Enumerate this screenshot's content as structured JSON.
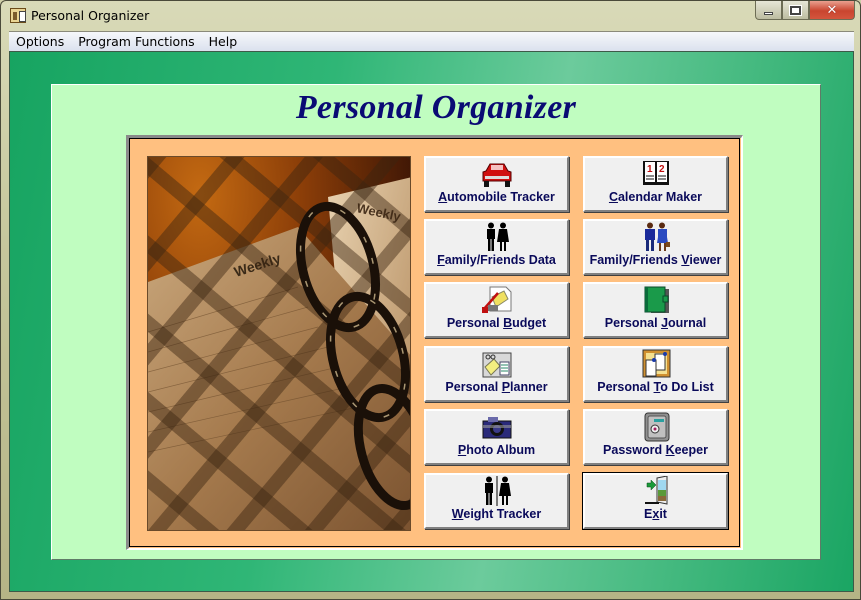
{
  "window": {
    "title": "Personal Organizer",
    "controls": {
      "minimize": "minimize",
      "maximize": "maximize",
      "close": "close"
    }
  },
  "menubar": {
    "items": [
      "Options",
      "Program Functions",
      "Help"
    ]
  },
  "main": {
    "heading": "Personal Organizer",
    "photo": {
      "caption_left": "Weekly",
      "caption_right": "Weekly"
    },
    "buttons": [
      {
        "label": "Automobile Tracker",
        "mnemonic_index": 0,
        "icon": "car-icon"
      },
      {
        "label": "Calendar Maker",
        "mnemonic_index": 0,
        "icon": "calendar-icon"
      },
      {
        "label": "Family/Friends Data",
        "mnemonic_index": 0,
        "icon": "people-icon"
      },
      {
        "label": "Family/Friends Viewer",
        "mnemonic_index": 15,
        "icon": "business-people-icon"
      },
      {
        "label": "Personal Budget",
        "mnemonic_index": 9,
        "icon": "budget-icon"
      },
      {
        "label": "Personal Journal",
        "mnemonic_index": 9,
        "icon": "journal-icon"
      },
      {
        "label": "Personal Planner",
        "mnemonic_index": 9,
        "icon": "planner-icon"
      },
      {
        "label": "Personal To Do List",
        "mnemonic_index": 9,
        "icon": "todo-list-icon"
      },
      {
        "label": "Photo Album",
        "mnemonic_index": 0,
        "icon": "camera-icon"
      },
      {
        "label": "Password Keeper",
        "mnemonic_index": 9,
        "icon": "safe-icon"
      },
      {
        "label": "Weight Tracker",
        "mnemonic_index": 0,
        "icon": "restroom-people-icon"
      },
      {
        "label": "Exit",
        "mnemonic_index": 1,
        "icon": "exit-door-icon"
      }
    ]
  },
  "colors": {
    "heading": "#0a0a74",
    "button_text": "#0a0a5a",
    "panel_bg": "#c0fdc0",
    "frame_bg": "#ffc080",
    "client_green": "#17a461"
  }
}
